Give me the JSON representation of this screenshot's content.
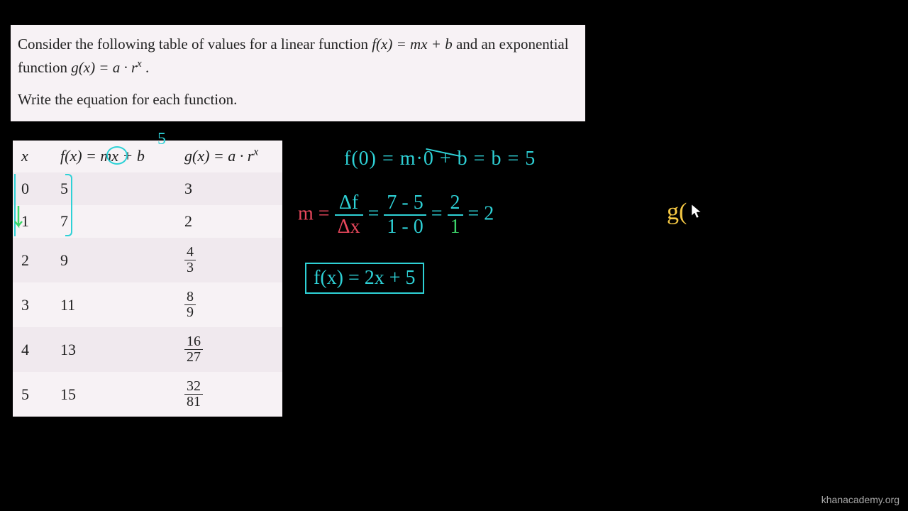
{
  "problem": {
    "line1_a": "Consider the following table of values for a linear function ",
    "line1_fx": "f(x) = mx + b",
    "line1_b": " and an",
    "line2_a": "exponential function ",
    "line2_gx": "g(x) = a · r",
    "line2_b": " .",
    "line3": "Write the equation for each function."
  },
  "table": {
    "header_x": "x",
    "header_fx_a": "f(x) = ",
    "header_fx_m": "m",
    "header_fx_b": "x + b",
    "header_gx": "g(x) = a · r",
    "rows": [
      {
        "x": "0",
        "fx": "5",
        "gx_n": "3",
        "gx_d": ""
      },
      {
        "x": "1",
        "fx": "7",
        "gx_n": "2",
        "gx_d": ""
      },
      {
        "x": "2",
        "fx": "9",
        "gx_n": "4",
        "gx_d": "3"
      },
      {
        "x": "3",
        "fx": "11",
        "gx_n": "8",
        "gx_d": "9"
      },
      {
        "x": "4",
        "fx": "13",
        "gx_n": "16",
        "gx_d": "27"
      },
      {
        "x": "5",
        "fx": "15",
        "gx_n": "32",
        "gx_d": "81"
      }
    ],
    "annot_5": "5"
  },
  "work": {
    "line1": "f(0) = m·0 + b  = b = 5",
    "m_eq": "m = ",
    "df": "Δf",
    "dx": "Δx",
    "eq1": " = ",
    "num1": "7 - 5",
    "den1": "1 - 0",
    "eq2": " = ",
    "num2": "2",
    "den2": "1",
    "eq3": " = 2",
    "final": "f(x) = 2x + 5",
    "g_start": "g("
  },
  "watermark": "khanacademy.org"
}
